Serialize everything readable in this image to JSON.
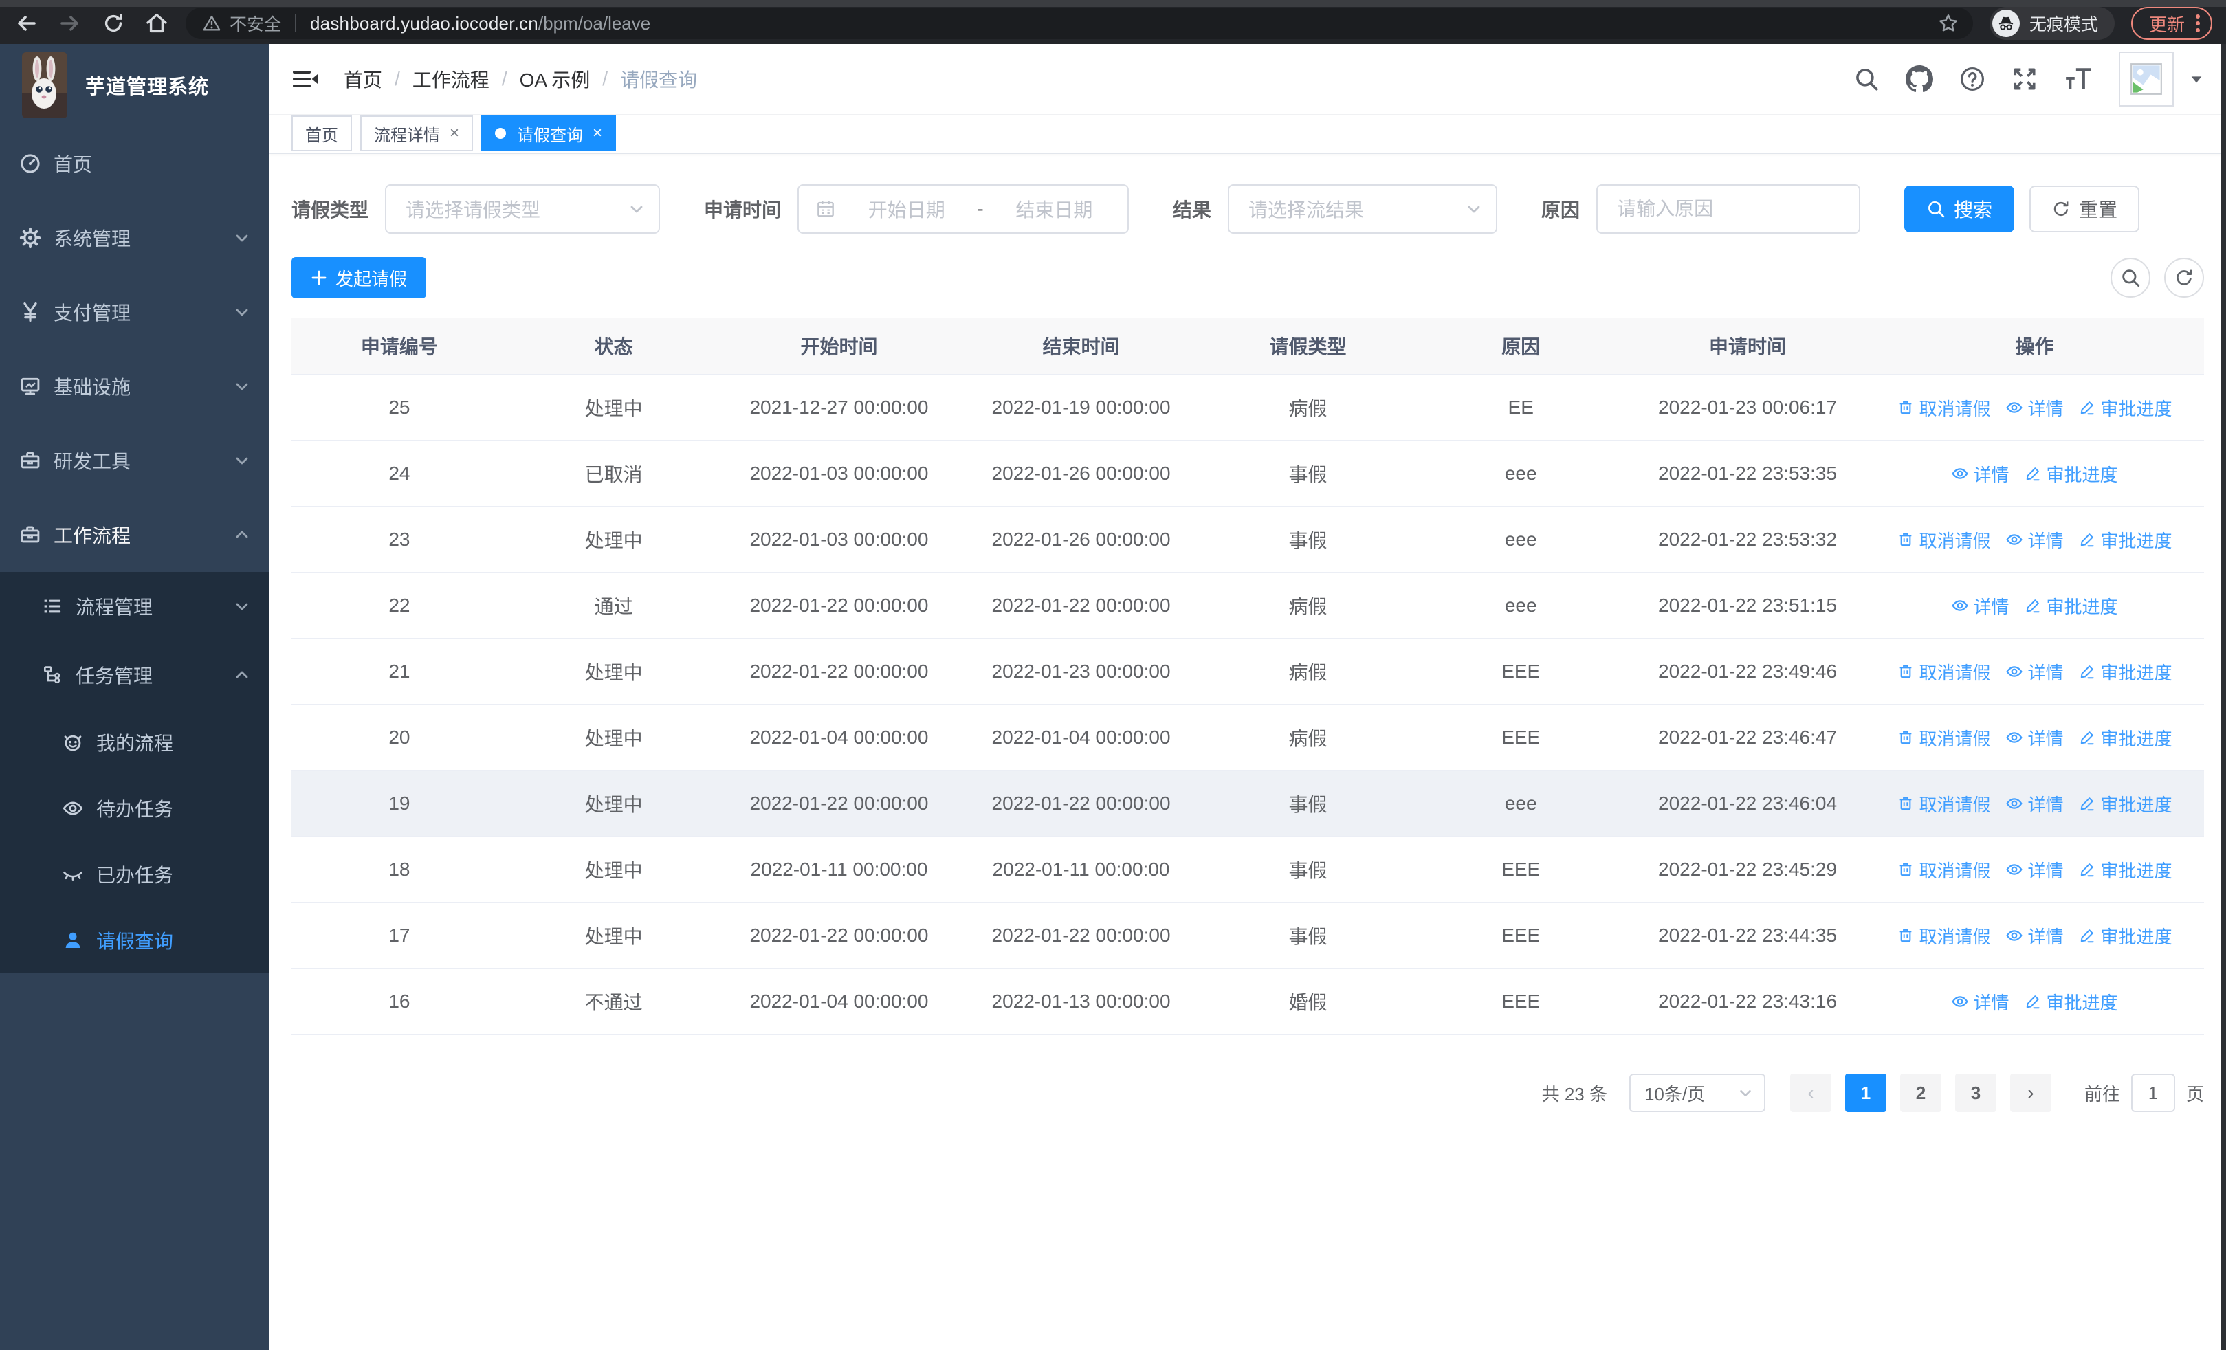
{
  "browser": {
    "security_label": "不安全",
    "url_host": "dashboard.yudao.iocoder.cn",
    "url_path": "/bpm/oa/leave",
    "incognito_label": "无痕模式",
    "update_label": "更新"
  },
  "sidebar": {
    "title": "芋道管理系统",
    "items": [
      {
        "label": "首页",
        "icon": "dashboard-icon"
      },
      {
        "label": "系统管理",
        "icon": "gear-icon"
      },
      {
        "label": "支付管理",
        "icon": "yen-icon"
      },
      {
        "label": "基础设施",
        "icon": "monitor-icon"
      },
      {
        "label": "研发工具",
        "icon": "toolbox-icon"
      },
      {
        "label": "工作流程",
        "icon": "briefcase-icon"
      }
    ],
    "submenu": [
      {
        "label": "流程管理",
        "icon": "list-icon"
      },
      {
        "label": "任务管理",
        "icon": "tree-icon"
      }
    ],
    "task_items": [
      {
        "label": "我的流程",
        "icon": "robot-icon"
      },
      {
        "label": "待办任务",
        "icon": "eye-icon"
      },
      {
        "label": "已办任务",
        "icon": "eye-closed-icon"
      },
      {
        "label": "请假查询",
        "icon": "user-icon"
      }
    ]
  },
  "header": {
    "breadcrumb": [
      "首页",
      "工作流程",
      "OA 示例",
      "请假查询"
    ]
  },
  "tabs": [
    {
      "label": "首页"
    },
    {
      "label": "流程详情"
    },
    {
      "label": "请假查询"
    }
  ],
  "filters": {
    "type_label": "请假类型",
    "type_placeholder": "请选择请假类型",
    "time_label": "申请时间",
    "start_placeholder": "开始日期",
    "range_separator": "-",
    "end_placeholder": "结束日期",
    "result_label": "结果",
    "result_placeholder": "请选择流结果",
    "reason_label": "原因",
    "reason_placeholder": "请输入原因",
    "search_label": "搜索",
    "reset_label": "重置"
  },
  "toolbar": {
    "create_label": "发起请假"
  },
  "table": {
    "columns": [
      "申请编号",
      "状态",
      "开始时间",
      "结束时间",
      "请假类型",
      "原因",
      "申请时间",
      "操作"
    ],
    "col_keys": [
      "id",
      "status",
      "start",
      "end",
      "type",
      "reason",
      "applyTime"
    ],
    "action_labels": {
      "cancel": "取消请假",
      "detail": "详情",
      "progress": "审批进度"
    },
    "rows": [
      {
        "id": "25",
        "status": "处理中",
        "start": "2021-12-27 00:00:00",
        "end": "2022-01-19 00:00:00",
        "type": "病假",
        "reason": "EE",
        "applyTime": "2022-01-23 00:06:17",
        "actions": [
          "cancel",
          "detail",
          "progress"
        ],
        "highlight": false
      },
      {
        "id": "24",
        "status": "已取消",
        "start": "2022-01-03 00:00:00",
        "end": "2022-01-26 00:00:00",
        "type": "事假",
        "reason": "eee",
        "applyTime": "2022-01-22 23:53:35",
        "actions": [
          "detail",
          "progress"
        ],
        "highlight": false
      },
      {
        "id": "23",
        "status": "处理中",
        "start": "2022-01-03 00:00:00",
        "end": "2022-01-26 00:00:00",
        "type": "事假",
        "reason": "eee",
        "applyTime": "2022-01-22 23:53:32",
        "actions": [
          "cancel",
          "detail",
          "progress"
        ],
        "highlight": false
      },
      {
        "id": "22",
        "status": "通过",
        "start": "2022-01-22 00:00:00",
        "end": "2022-01-22 00:00:00",
        "type": "病假",
        "reason": "eee",
        "applyTime": "2022-01-22 23:51:15",
        "actions": [
          "detail",
          "progress"
        ],
        "highlight": false
      },
      {
        "id": "21",
        "status": "处理中",
        "start": "2022-01-22 00:00:00",
        "end": "2022-01-23 00:00:00",
        "type": "病假",
        "reason": "EEE",
        "applyTime": "2022-01-22 23:49:46",
        "actions": [
          "cancel",
          "detail",
          "progress"
        ],
        "highlight": false
      },
      {
        "id": "20",
        "status": "处理中",
        "start": "2022-01-04 00:00:00",
        "end": "2022-01-04 00:00:00",
        "type": "病假",
        "reason": "EEE",
        "applyTime": "2022-01-22 23:46:47",
        "actions": [
          "cancel",
          "detail",
          "progress"
        ],
        "highlight": false
      },
      {
        "id": "19",
        "status": "处理中",
        "start": "2022-01-22 00:00:00",
        "end": "2022-01-22 00:00:00",
        "type": "事假",
        "reason": "eee",
        "applyTime": "2022-01-22 23:46:04",
        "actions": [
          "cancel",
          "detail",
          "progress"
        ],
        "highlight": true
      },
      {
        "id": "18",
        "status": "处理中",
        "start": "2022-01-11 00:00:00",
        "end": "2022-01-11 00:00:00",
        "type": "事假",
        "reason": "EEE",
        "applyTime": "2022-01-22 23:45:29",
        "actions": [
          "cancel",
          "detail",
          "progress"
        ],
        "highlight": false
      },
      {
        "id": "17",
        "status": "处理中",
        "start": "2022-01-22 00:00:00",
        "end": "2022-01-22 00:00:00",
        "type": "事假",
        "reason": "EEE",
        "applyTime": "2022-01-22 23:44:35",
        "actions": [
          "cancel",
          "detail",
          "progress"
        ],
        "highlight": false
      },
      {
        "id": "16",
        "status": "不通过",
        "start": "2022-01-04 00:00:00",
        "end": "2022-01-13 00:00:00",
        "type": "婚假",
        "reason": "EEE",
        "applyTime": "2022-01-22 23:43:16",
        "actions": [
          "detail",
          "progress"
        ],
        "highlight": false
      }
    ]
  },
  "pagination": {
    "total_label": "共 23 条",
    "page_size": "10条/页",
    "pages": [
      "1",
      "2",
      "3"
    ],
    "active_page": "1",
    "goto_label": "前往",
    "goto_value": "1",
    "page_unit": "页"
  },
  "colors": {
    "primary": "#1890ff",
    "link": "#409eff",
    "sidebar_bg": "#304156",
    "submenu_bg": "#1f2d3d",
    "update_accent": "#ee887d"
  }
}
